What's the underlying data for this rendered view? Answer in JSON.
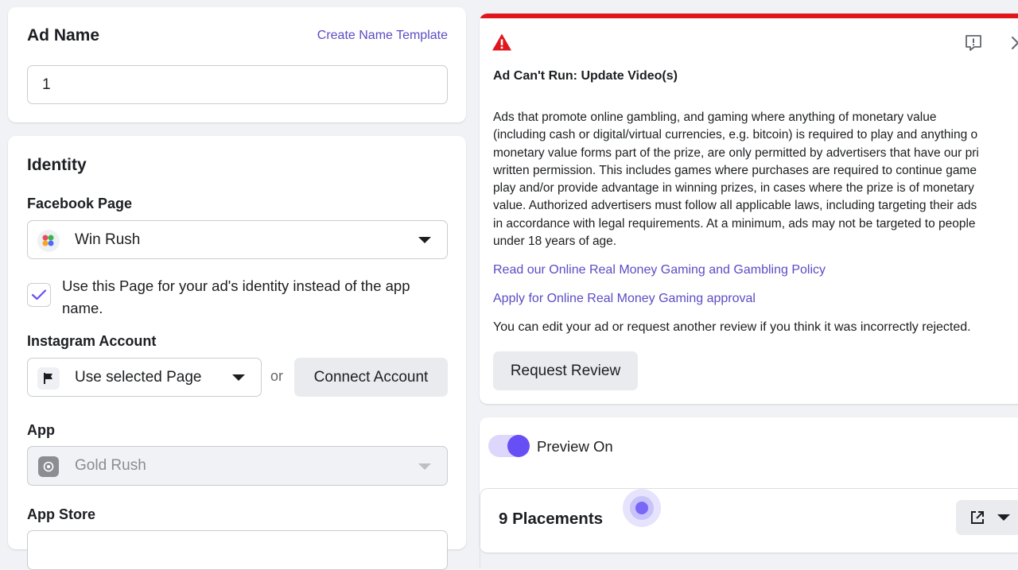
{
  "ad_name": {
    "title": "Ad Name",
    "template_link": "Create Name Template",
    "value": "1"
  },
  "identity": {
    "title": "Identity",
    "facebook_page_label": "Facebook Page",
    "facebook_page_value": "Win Rush",
    "checkbox_text_line1": "Use this Page for your ad's identity instead of the app",
    "checkbox_text_line2": "name.",
    "instagram_label": "Instagram Account",
    "instagram_value": "Use selected Page",
    "or_text": "or",
    "connect_button": "Connect Account",
    "app_label": "App",
    "app_value": "Gold Rush",
    "app_store_label": "App Store"
  },
  "alert": {
    "title": "Ad Can't Run: Update Video(s)",
    "body_lines": [
      "Ads that promote online gambling, and gaming where anything of monetary value",
      "(including cash or digital/virtual currencies, e.g. bitcoin) is required to play and anything o",
      "monetary value forms part of the prize, are only permitted by advertisers that have our pri",
      "written permission. This includes games where purchases are required to continue game",
      "play and/or provide advantage in winning prizes, in cases where the prize is of monetary",
      "value. Authorized advertisers must follow all applicable laws, including targeting their ads",
      "in accordance with legal requirements. At a minimum, ads may not be targeted to people",
      "under 18 years of age."
    ],
    "policy_link": "Read our Online Real Money Gaming and Gambling Policy",
    "approval_link": "Apply for Online Real Money Gaming approval",
    "edit_text": "You can edit your ad or request another review if you think it was incorrectly rejected.",
    "request_button": "Request Review",
    "accent_color": "#e0161e"
  },
  "preview": {
    "toggle_label": "Preview On",
    "toggle_on": true,
    "accent_color": "#6650f5"
  },
  "placements": {
    "title": "9 Placements"
  }
}
